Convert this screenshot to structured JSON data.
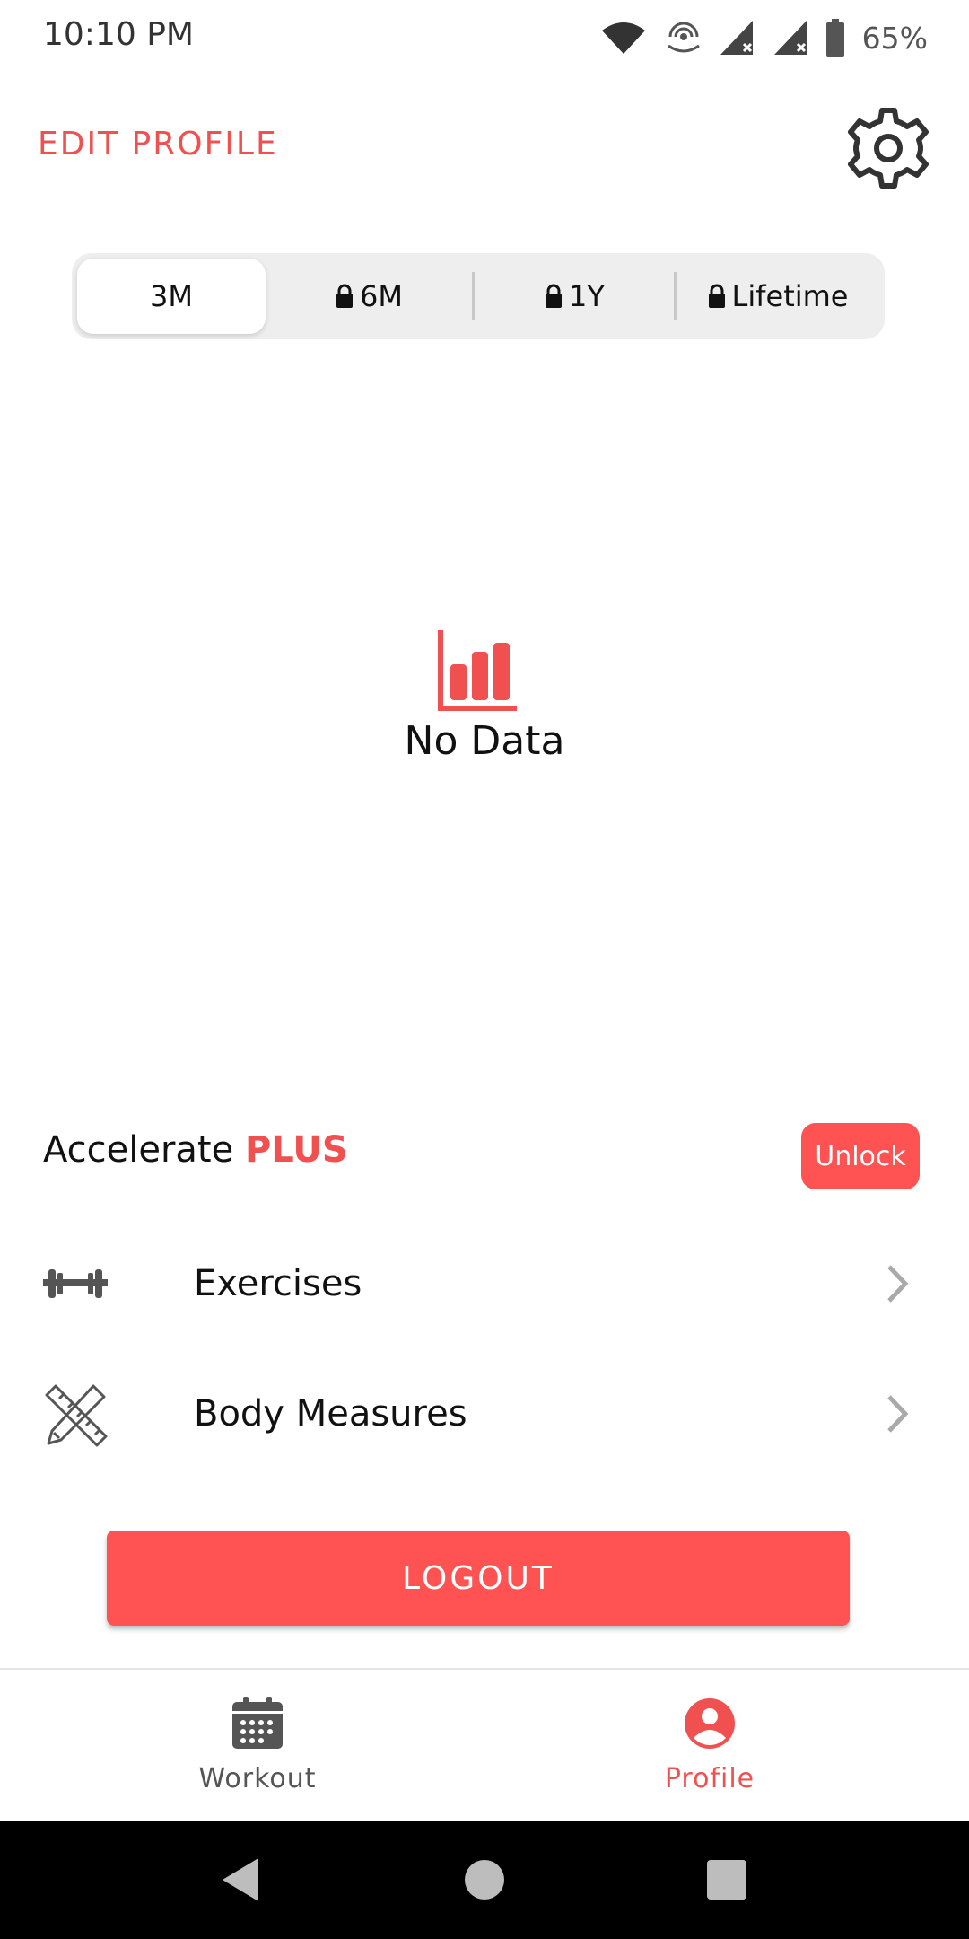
{
  "status_bar": {
    "time": "10:10 PM",
    "battery_percent": "65%",
    "icons": [
      "wifi-icon",
      "hotspot-icon",
      "signal-icon",
      "signal-icon",
      "battery-icon"
    ]
  },
  "header": {
    "edit_profile_label": "EDIT PROFILE",
    "settings_icon": "gear-icon"
  },
  "range_tabs": {
    "items": [
      {
        "label": "3M",
        "locked": false,
        "selected": true
      },
      {
        "label": "6M",
        "locked": true,
        "selected": false
      },
      {
        "label": "1Y",
        "locked": true,
        "selected": false
      },
      {
        "label": "Lifetime",
        "locked": true,
        "selected": false
      }
    ]
  },
  "chart": {
    "empty_icon": "bar-chart-icon",
    "empty_text": "No Data"
  },
  "plus": {
    "prefix": "Accelerate",
    "highlight": "PLUS",
    "unlock_label": "Unlock"
  },
  "menu": {
    "items": [
      {
        "label": "Exercises",
        "icon": "dumbbell-icon"
      },
      {
        "label": "Body Measures",
        "icon": "ruler-pencil-icon"
      }
    ]
  },
  "logout_label": "LOGOUT",
  "bottom_nav": {
    "items": [
      {
        "label": "Workout",
        "icon": "calendar-icon",
        "active": false
      },
      {
        "label": "Profile",
        "icon": "user-circle-icon",
        "active": true
      }
    ]
  },
  "colors": {
    "accent": "#FF5252",
    "accent_text": "#F05050",
    "inactive": "#555555",
    "tab_track": "#EEEEEE"
  }
}
